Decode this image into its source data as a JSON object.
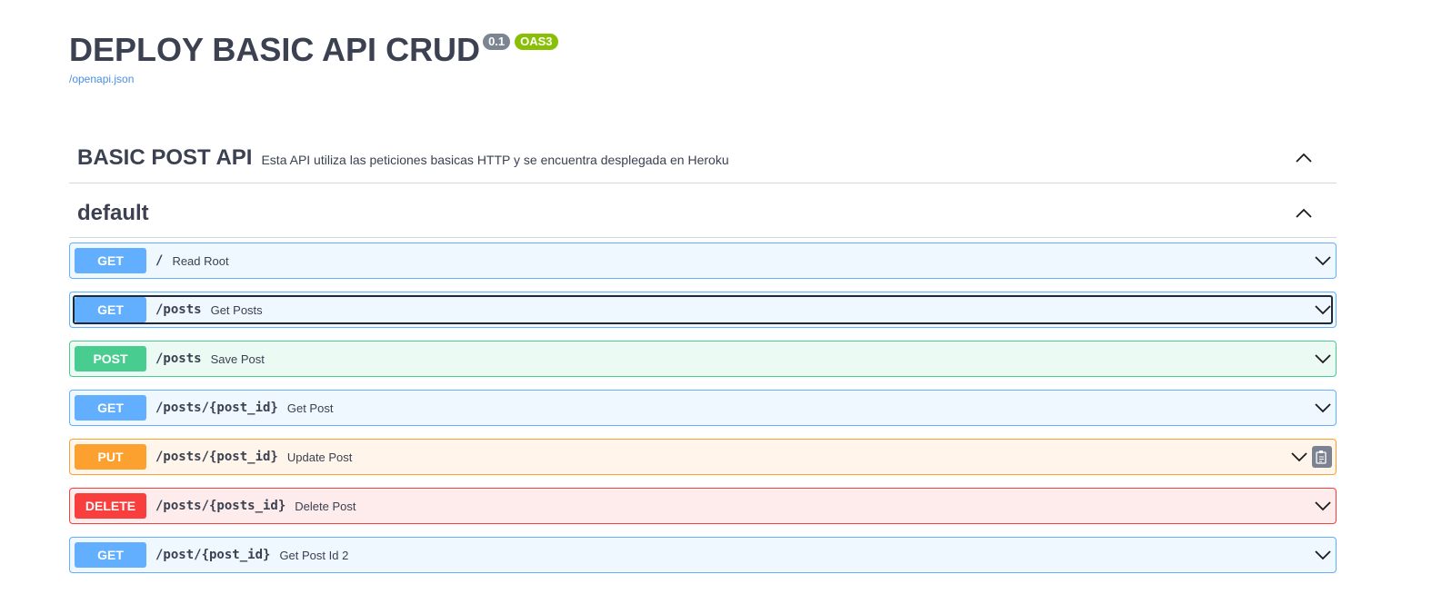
{
  "info": {
    "title": "DEPLOY BASIC API CRUD",
    "version": "0.1",
    "oas": "OAS3",
    "spec_link": "/openapi.json"
  },
  "tags": [
    {
      "name": "BASIC POST API",
      "description": "Esta API utiliza las peticiones basicas HTTP y se encuentra desplegada en Heroku"
    },
    {
      "name": "default",
      "description": ""
    }
  ],
  "operations": [
    {
      "method": "GET",
      "path": "/",
      "summary": "Read Root"
    },
    {
      "method": "GET",
      "path": "/posts",
      "summary": "Get Posts"
    },
    {
      "method": "POST",
      "path": "/posts",
      "summary": "Save Post"
    },
    {
      "method": "GET",
      "path": "/posts/{post_id}",
      "summary": "Get Post"
    },
    {
      "method": "PUT",
      "path": "/posts/{post_id}",
      "summary": "Update Post"
    },
    {
      "method": "DELETE",
      "path": "/posts/{posts_id}",
      "summary": "Delete Post"
    },
    {
      "method": "GET",
      "path": "/post/{post_id}",
      "summary": "Get Post Id 2"
    }
  ],
  "colors": {
    "get": "#61affe",
    "post": "#49cc90",
    "put": "#fca130",
    "delete": "#f93e3e",
    "text": "#3b4151",
    "link": "#4990e2"
  },
  "icons": {
    "collapse": "chevron-up-icon",
    "expand": "chevron-down-icon",
    "copy": "clipboard-copy-icon"
  }
}
